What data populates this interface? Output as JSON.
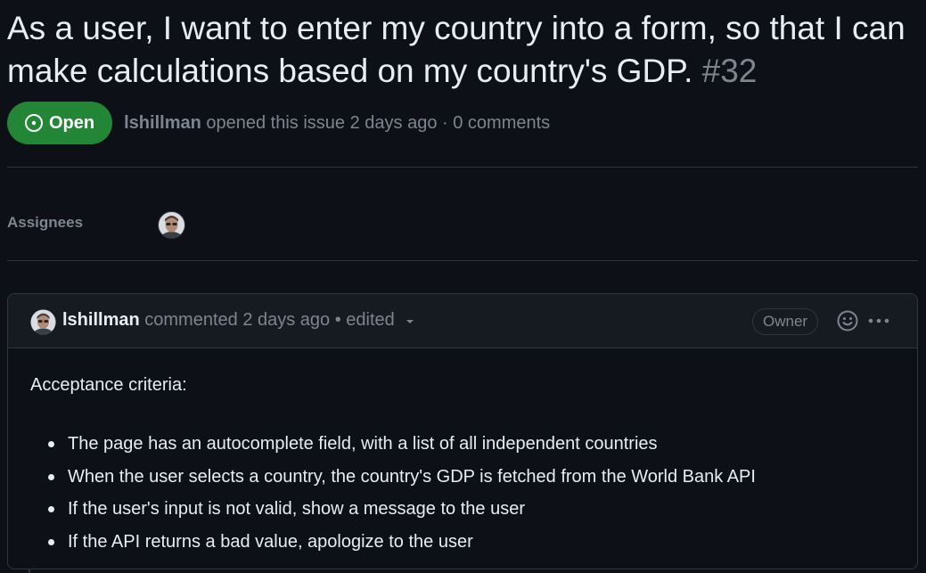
{
  "issue": {
    "title": "As a user, I want to enter my country into a form, so that I can make calculations based on my country's GDP.",
    "number": "#32",
    "state": "Open",
    "author": "lshillman",
    "opened_text": "opened this issue 2 days ago · 0 comments"
  },
  "sidebar": {
    "assignees_label": "Assignees"
  },
  "comment": {
    "author": "lshillman",
    "meta": "commented 2 days ago • edited",
    "role_badge": "Owner",
    "body_heading": "Acceptance criteria:",
    "criteria": [
      "The page has an autocomplete field, with a list of all independent countries",
      "When the user selects a country, the country's GDP is fetched from the World Bank API",
      "If the user's input is not valid, show a message to the user",
      "If the API returns a bad value, apologize to the user"
    ]
  },
  "icons": {
    "state": "issue-opened-icon",
    "reaction": "smiley-icon",
    "menu": "kebab-horizontal-icon",
    "edited_menu": "triangle-down-icon"
  },
  "colors": {
    "background": "#0d1117",
    "open_badge": "#238636",
    "muted_text": "#7d8590",
    "border": "#30363d"
  }
}
